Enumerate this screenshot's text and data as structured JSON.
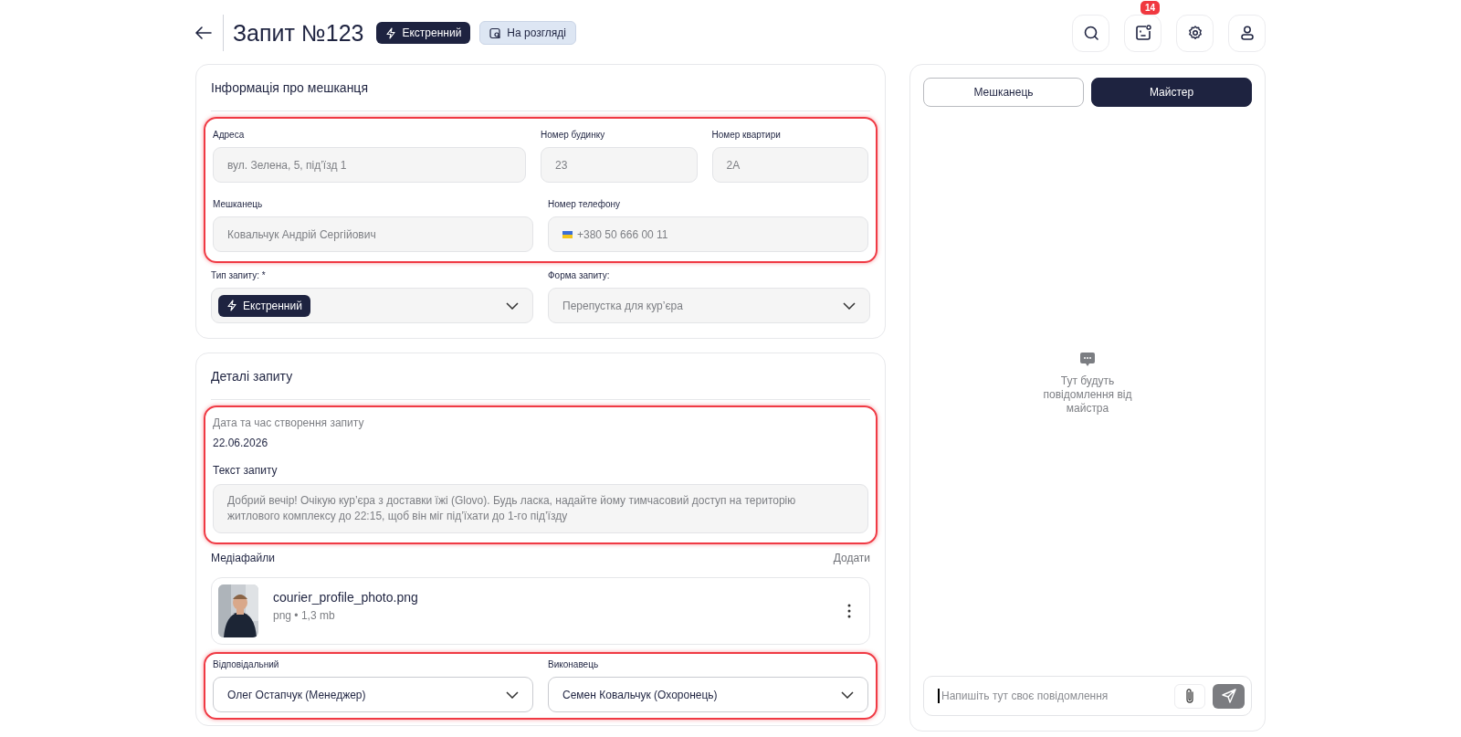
{
  "header": {
    "title": "Запит №123",
    "badges": [
      {
        "kind": "urgent",
        "label": "Екстренний"
      },
      {
        "kind": "review",
        "label": "На розгляді"
      }
    ]
  },
  "toolbar": {
    "notifications_count": "14"
  },
  "resident_card": {
    "title": "Інформація про мешканця",
    "highlighted": true,
    "rows": [
      [
        {
          "kind": "text",
          "label": "Адреса",
          "value": "вул. Зелена, 5, під’їзд 1"
        },
        {
          "kind": "text",
          "label": "Номер будинку",
          "value": "23"
        },
        {
          "kind": "text",
          "label": "Номер квартири",
          "value": "2A"
        }
      ],
      [
        {
          "kind": "text",
          "label": "Мешканець",
          "value": "Ковальчук Андрій Сергійович"
        },
        {
          "kind": "phone",
          "label": "Номер телефону",
          "value": "+380 50 666 00 11"
        }
      ]
    ],
    "selects": [
      {
        "kind": "chip",
        "label": "Тип запиту: *",
        "value": "Екстренний"
      },
      {
        "kind": "plain",
        "label": "Форма запиту:",
        "value": "Перепустка для кур’єра"
      }
    ]
  },
  "details_card": {
    "title": "Деталі запиту",
    "highlighted": true,
    "date_label": "Дата та час створення запиту",
    "date": "22.06.2026",
    "text_label": "Текст запиту",
    "text": "Добрий вечір! Очікую кур’єра з доставки їжі (Glovo). Будь ласка, надайте йому тимчасовий доступ на територію житлового комплексу до 22:15, щоб він міг під’їхати до 1-го під’їзду",
    "media": {
      "label": "Медіафайли",
      "add": "Додати",
      "files": [
        {
          "kind": "picture",
          "name": "courier_profile_photo.png",
          "meta": "png • 1,3 mb"
        }
      ]
    },
    "assignees": {
      "highlighted": true,
      "selects": [
        {
          "label": "Відповідальний",
          "value": "Олег Остапчук (Менеджер)"
        },
        {
          "label": "Виконавець",
          "value": "Семен Ковальчук (Охоронець)"
        }
      ]
    }
  },
  "chat": {
    "tabs": [
      {
        "label": "Мешканець",
        "selected": false
      },
      {
        "label": "Майстер",
        "selected": true
      }
    ],
    "empty_text": "Тут будуть повідомлення від майстра",
    "placeholder": "Напишіть тут своє повідомлення"
  }
}
